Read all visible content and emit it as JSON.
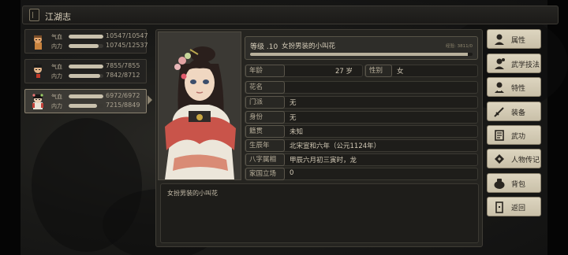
{
  "window": {
    "title": "江湖志"
  },
  "characters": [
    {
      "name_hp": "气血",
      "name_mp": "内力",
      "hp": "10547/10547",
      "mp": "10745/12537",
      "hp_fraction": 1.0,
      "mp_fraction": 0.857,
      "selected": false
    },
    {
      "name_hp": "气血",
      "name_mp": "内力",
      "hp": "7855/7855",
      "mp": "7842/8712",
      "hp_fraction": 1.0,
      "mp_fraction": 0.9,
      "selected": false
    },
    {
      "name_hp": "气血",
      "name_mp": "内力",
      "hp": "6972/6972",
      "mp": "7215/8849",
      "hp_fraction": 1.0,
      "mp_fraction": 0.815,
      "selected": true
    }
  ],
  "profile": {
    "level_label": "等级 .10",
    "title": "女扮男装的小叫花",
    "exp_text": "经验: 3811/0",
    "exp_fraction": 0.98,
    "age_label": "年龄",
    "age_value": "27 岁",
    "gender_label": "性别",
    "gender_value": "女",
    "fields": [
      {
        "label": "花名",
        "value": ""
      },
      {
        "label": "门派",
        "value": "无"
      },
      {
        "label": "身份",
        "value": "无"
      },
      {
        "label": "籍贯",
        "value": "未知"
      },
      {
        "label": "生辰年",
        "value": "北宋宣和六年（公元1124年）"
      },
      {
        "label": "八字属相",
        "value": "甲辰六月初三寅时，龙"
      },
      {
        "label": "家国立场",
        "value": "0"
      }
    ],
    "description": "女扮男装的小叫花"
  },
  "menu": [
    {
      "label": "属性",
      "icon": "attributes-icon"
    },
    {
      "label": "武学技法",
      "icon": "martial-skills-icon"
    },
    {
      "label": "特性",
      "icon": "traits-icon"
    },
    {
      "label": "装备",
      "icon": "sword-icon"
    },
    {
      "label": "武功",
      "icon": "kungfu-icon"
    },
    {
      "label": "人物传记",
      "icon": "biography-icon"
    },
    {
      "label": "背包",
      "icon": "bag-icon"
    },
    {
      "label": "返回",
      "icon": "return-icon"
    }
  ],
  "colors": {
    "menu_bg": "#d6cdb7",
    "panel_bg": "#252420",
    "bar_fill": "#c9c1ad"
  }
}
